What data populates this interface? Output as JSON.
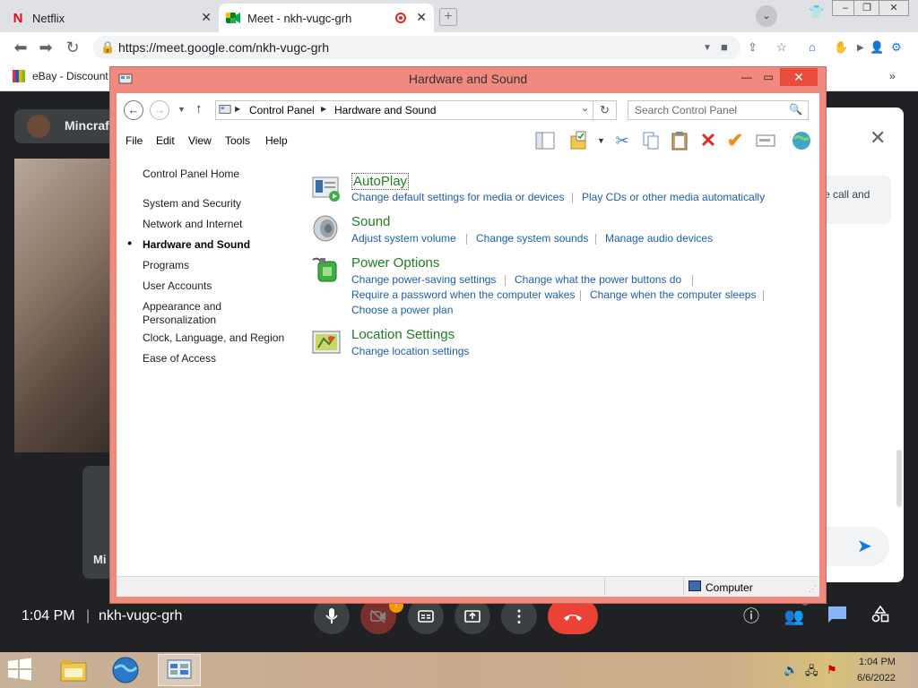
{
  "browser": {
    "tabs": [
      {
        "label": "Netflix",
        "icon": "netflix-icon"
      },
      {
        "label": "Meet - nkh-vugc-grh",
        "icon": "meet-icon"
      }
    ],
    "url": "https://meet.google.com/nkh-vugc-grh",
    "bookmark": "eBay - Discount"
  },
  "meet": {
    "participant_name": "Mincraf",
    "participant2_name": "Mi",
    "time": "1:04 PM",
    "separator": "|",
    "meeting_code": "nkh-vugc-grh",
    "chat_snippet": "e call and",
    "close_glyph": "✕",
    "send_glyph": "➤"
  },
  "control_panel": {
    "title": "Hardware and Sound",
    "breadcrumb": [
      "Control Panel",
      "Hardware and Sound"
    ],
    "search_placeholder": "Search Control Panel",
    "menu": [
      "File",
      "Edit",
      "View",
      "Tools",
      "Help"
    ],
    "nav": {
      "home": "Control Panel Home",
      "items": [
        "System and Security",
        "Network and Internet",
        "Hardware and Sound",
        "Programs",
        "User Accounts",
        "Appearance and",
        "Personalization",
        "Clock, Language, and Region",
        "Ease of Access"
      ],
      "active": "Hardware and Sound"
    },
    "categories": [
      {
        "title": "AutoPlay",
        "links": [
          "Change default settings for media or devices",
          "Play CDs or other media automatically"
        ]
      },
      {
        "title": "Sound",
        "links": [
          "Adjust system volume",
          "Change system sounds",
          "Manage audio devices"
        ]
      },
      {
        "title": "Power Options",
        "links": [
          "Change power-saving settings",
          "Change what the power buttons do",
          "Require a password when the computer wakes",
          "Change when the computer sleeps",
          "Choose a power plan"
        ]
      },
      {
        "title": "Location Settings",
        "links": [
          "Change location settings"
        ]
      }
    ],
    "status": "Computer"
  },
  "taskbar": {
    "time": "1:04 PM",
    "date": "6/6/2022"
  },
  "colors": {
    "window_frame": "#f08a7e",
    "category_title": "#1e7d1e",
    "link": "#1e5fa8",
    "end_call": "#ea4335"
  }
}
